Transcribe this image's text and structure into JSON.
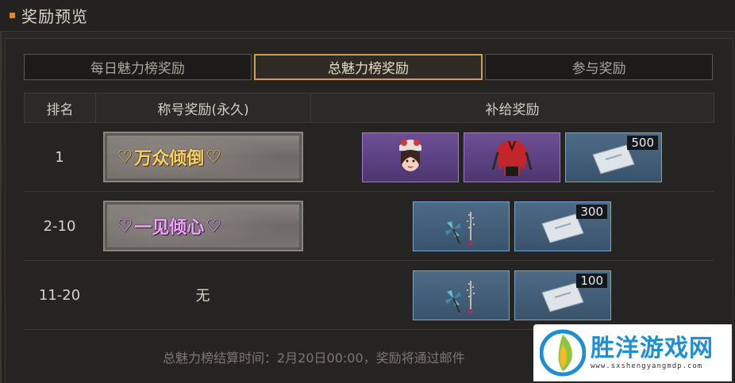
{
  "window": {
    "title": "奖励预览"
  },
  "tabs": [
    {
      "label": "每日魅力榜奖励",
      "active": false
    },
    {
      "label": "总魅力榜奖励",
      "active": true
    },
    {
      "label": "参与奖励",
      "active": false
    }
  ],
  "table": {
    "headers": [
      "排名",
      "称号奖励(永久)",
      "补给奖励"
    ],
    "rows": [
      {
        "rank": "1",
        "title_badge": "万众倾倒",
        "title_color": "#f3cf6e",
        "rewards": [
          {
            "icon": "character-head-item-icon",
            "rarity": "purple",
            "count": ""
          },
          {
            "icon": "red-jacket-item-icon",
            "rarity": "purple",
            "count": ""
          },
          {
            "icon": "coupon-pack-icon",
            "rarity": "blue",
            "count": "500"
          }
        ]
      },
      {
        "rank": "2-10",
        "title_badge": "一见倾心",
        "title_color": "#e7a8ef",
        "rewards": [
          {
            "icon": "firework-pinwheel-icon",
            "rarity": "blue",
            "count": ""
          },
          {
            "icon": "coupon-pack-icon",
            "rarity": "blue",
            "count": "300"
          }
        ]
      },
      {
        "rank": "11-20",
        "title_text": "无",
        "rewards": [
          {
            "icon": "firework-pinwheel-icon",
            "rarity": "blue",
            "count": ""
          },
          {
            "icon": "coupon-pack-icon",
            "rarity": "blue",
            "count": "100"
          }
        ]
      }
    ]
  },
  "footer": {
    "note": "总魅力榜结算时间：2月20日00:00，奖励将通过邮件"
  },
  "watermark": {
    "main": "胜洋游戏网",
    "sub": "www.sxshengyangmdp.com"
  },
  "colors": {
    "accent": "#e08a2c",
    "active_tab_border": "#d59a54"
  }
}
